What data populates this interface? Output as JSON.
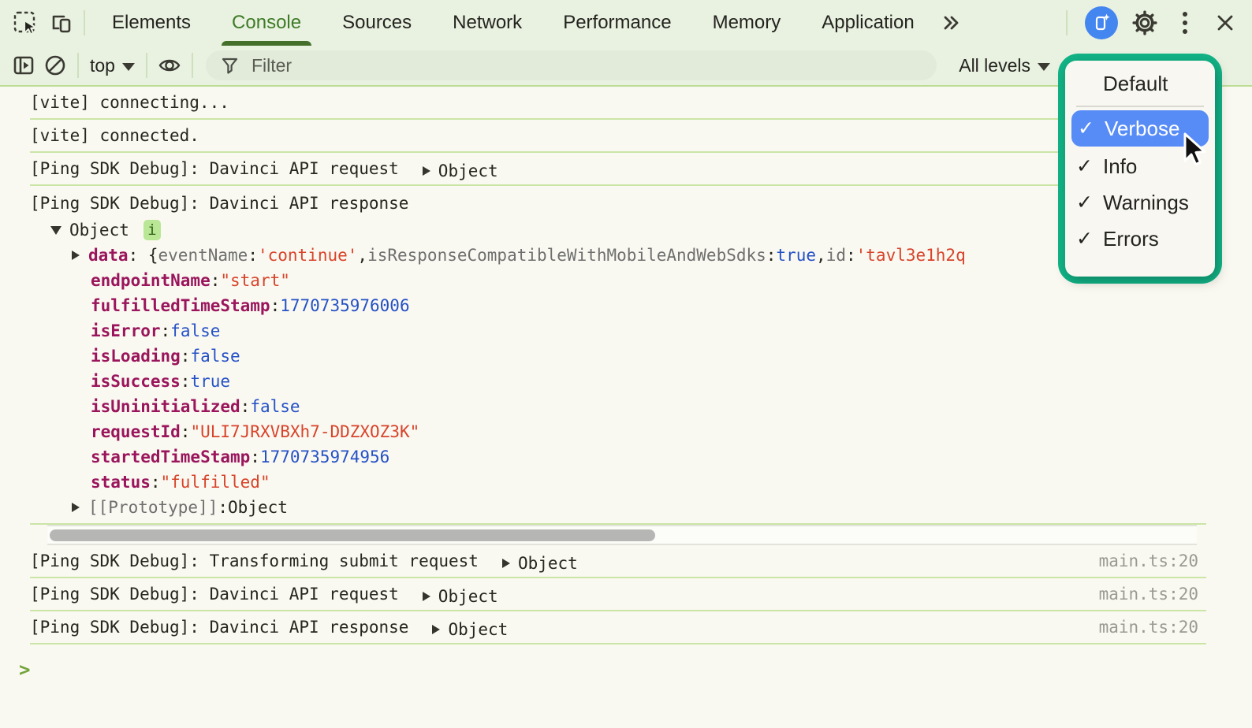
{
  "tabbar": {
    "tabs": [
      {
        "label": "Elements",
        "active": false
      },
      {
        "label": "Console",
        "active": true
      },
      {
        "label": "Sources",
        "active": false
      },
      {
        "label": "Network",
        "active": false
      },
      {
        "label": "Performance",
        "active": false
      },
      {
        "label": "Memory",
        "active": false
      },
      {
        "label": "Application",
        "active": false
      }
    ],
    "left_icons": [
      "inspect-icon",
      "device-toolbar-icon"
    ],
    "overflow_icon": "more-tabs-chevrons-icon",
    "right_icons": [
      "ai-assistant-icon",
      "settings-gear-icon",
      "more-options-kebab-icon",
      "close-icon"
    ]
  },
  "console_toolbar": {
    "icons": [
      "dock-side-icon",
      "clear-console-icon",
      "live-expression-eye-icon"
    ],
    "context_selector": "top",
    "filter_placeholder": "Filter",
    "levels_selector": "All levels"
  },
  "levels_menu": {
    "items": [
      {
        "label": "Default",
        "checked": false,
        "selected": false
      },
      {
        "label": "Verbose",
        "checked": true,
        "selected": true
      },
      {
        "label": "Info",
        "checked": true,
        "selected": false
      },
      {
        "label": "Warnings",
        "checked": true,
        "selected": false
      },
      {
        "label": "Errors",
        "checked": true,
        "selected": false
      }
    ]
  },
  "console": {
    "prompt": ">",
    "messages": [
      {
        "type": "plain",
        "text": "[vite] connecting..."
      },
      {
        "type": "plain",
        "text": "[vite] connected."
      },
      {
        "type": "collapsed",
        "text": "[Ping SDK Debug]: Davinci API request",
        "object_label": "Object"
      },
      {
        "type": "expanded",
        "text": "[Ping SDK Debug]: Davinci API response",
        "root_label": "Object",
        "info_badge": "i",
        "preview": [
          {
            "style": "name",
            "text": "data"
          },
          {
            "style": "plain",
            "text": ": {"
          },
          {
            "style": "key",
            "text": "eventName"
          },
          {
            "style": "plain",
            "text": ": "
          },
          {
            "style": "string",
            "text": "'continue'"
          },
          {
            "style": "plain",
            "text": ", "
          },
          {
            "style": "key",
            "text": "isResponseCompatibleWithMobileAndWebSdks"
          },
          {
            "style": "plain",
            "text": ": "
          },
          {
            "style": "keyword",
            "text": "true"
          },
          {
            "style": "plain",
            "text": ", "
          },
          {
            "style": "key",
            "text": "id"
          },
          {
            "style": "plain",
            "text": ": "
          },
          {
            "style": "string",
            "text": "'tavl3e1h2q"
          }
        ],
        "properties": [
          {
            "name": "endpointName",
            "value": "\"start\"",
            "vtype": "string"
          },
          {
            "name": "fulfilledTimeStamp",
            "value": "1770735976006",
            "vtype": "number"
          },
          {
            "name": "isError",
            "value": "false",
            "vtype": "keyword"
          },
          {
            "name": "isLoading",
            "value": "false",
            "vtype": "keyword"
          },
          {
            "name": "isSuccess",
            "value": "true",
            "vtype": "keyword"
          },
          {
            "name": "isUninitialized",
            "value": "false",
            "vtype": "keyword"
          },
          {
            "name": "requestId",
            "value": "\"ULI7JRXVBXh7-DDZXOZ3K\"",
            "vtype": "string"
          },
          {
            "name": "startedTimeStamp",
            "value": "1770735974956",
            "vtype": "number"
          },
          {
            "name": "status",
            "value": "\"fulfilled\"",
            "vtype": "string"
          }
        ],
        "prototype_key": "[[Prototype]]",
        "prototype_value": "Object",
        "hscrollbar": true
      },
      {
        "type": "collapsed",
        "text": "[Ping SDK Debug]: Transforming submit request",
        "object_label": "Object",
        "source": "main.ts:20"
      },
      {
        "type": "collapsed",
        "text": "[Ping SDK Debug]: Davinci API request",
        "object_label": "Object",
        "source": "main.ts:20"
      },
      {
        "type": "collapsed",
        "text": "[Ping SDK Debug]: Davinci API response",
        "object_label": "Object",
        "source": "main.ts:20"
      }
    ]
  },
  "colors": {
    "toolbar_background": "#e9f1e1",
    "active_tab_green": "#3e7b26",
    "row_separator_green": "#cbe5a7",
    "property_name_magenta": "#9a155c",
    "string_red": "#d8432a",
    "number_blue": "#2451c6",
    "selected_item_blue": "#578cf7",
    "annotation_teal": "#12b487",
    "ai_icon_blue": "#4486f0",
    "console_background": "#faf9f1"
  }
}
